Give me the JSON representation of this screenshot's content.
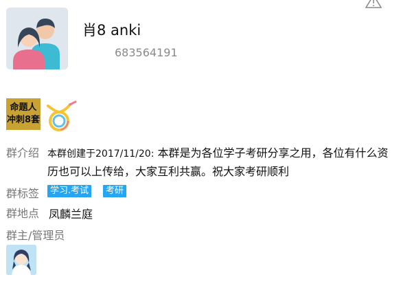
{
  "header": {
    "group_name": "肖8 anki",
    "group_id": "683564191"
  },
  "album": {
    "line1": "命题人",
    "line2": "冲刺8套"
  },
  "intro": {
    "label": "群介绍",
    "prefix": "本群创建于2017/11/20:",
    "body": " 本群是为各位学子考研分享之用，各位有什么资历也可以上传给，大家互利共赢。祝大家考研顺利"
  },
  "tags": {
    "label": "群标签",
    "items": [
      "学习.考试",
      "考研"
    ]
  },
  "location": {
    "label": "群地点",
    "value": "凤麟兰庭"
  },
  "admins": {
    "label": "群主/管理员"
  },
  "colors": {
    "tag_bg": "#26a5f2",
    "label": "#777777",
    "id": "#8a8a8a"
  }
}
